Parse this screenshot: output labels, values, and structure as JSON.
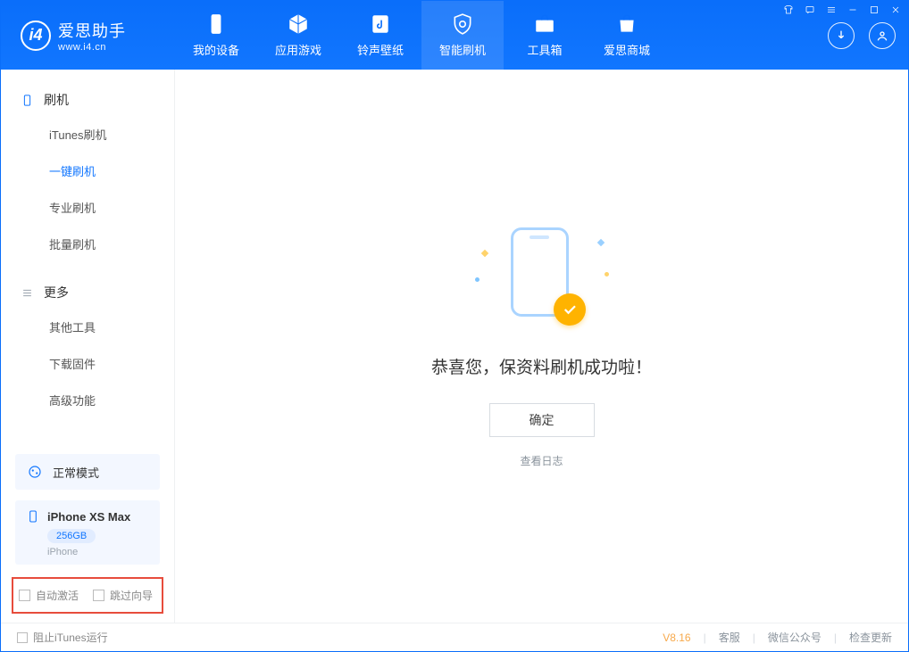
{
  "brand": {
    "title": "爱思助手",
    "subtitle": "www.i4.cn"
  },
  "nav": {
    "items": [
      {
        "label": "我的设备"
      },
      {
        "label": "应用游戏"
      },
      {
        "label": "铃声壁纸"
      },
      {
        "label": "智能刷机"
      },
      {
        "label": "工具箱"
      },
      {
        "label": "爱思商城"
      }
    ]
  },
  "sidebar": {
    "section1": {
      "title": "刷机",
      "items": [
        {
          "label": "iTunes刷机"
        },
        {
          "label": "一键刷机"
        },
        {
          "label": "专业刷机"
        },
        {
          "label": "批量刷机"
        }
      ]
    },
    "section2": {
      "title": "更多",
      "items": [
        {
          "label": "其他工具"
        },
        {
          "label": "下载固件"
        },
        {
          "label": "高级功能"
        }
      ]
    },
    "mode_card": {
      "label": "正常模式"
    },
    "device_card": {
      "name": "iPhone XS Max",
      "storage": "256GB",
      "type": "iPhone"
    },
    "options": {
      "auto_activate": "自动激活",
      "skip_guide": "跳过向导"
    }
  },
  "main": {
    "success_text": "恭喜您，保资料刷机成功啦！",
    "ok_button": "确定",
    "view_log": "查看日志"
  },
  "footer": {
    "block_itunes": "阻止iTunes运行",
    "version": "V8.16",
    "links": [
      "客服",
      "微信公众号",
      "检查更新"
    ]
  }
}
